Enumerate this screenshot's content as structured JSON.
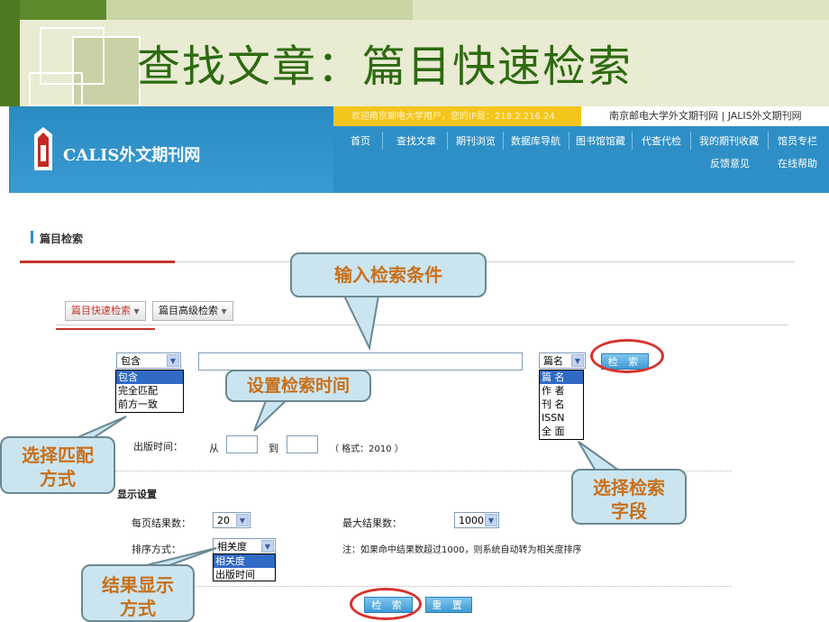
{
  "slide": {
    "title": "查找文章：篇目快速检索"
  },
  "site": {
    "welcome": "欢迎南京邮电大学用户，您的IP是：218.2.216.24",
    "top_links": "南京邮电大学外文期刊网 | JALIS外文期刊网",
    "logo_text": "CALIS外文期刊网",
    "nav_row1": [
      "首页",
      "查找文章",
      "期刊浏览",
      "数据库导航",
      "图书馆馆藏",
      "代查代检",
      "我的期刊收藏",
      "馆员专栏"
    ],
    "nav_row2": [
      "反馈意见",
      "在线帮助"
    ]
  },
  "page": {
    "section_title": "篇目检索",
    "tabs": [
      "篇目快速检索",
      "篇目高级检索"
    ],
    "match_select": {
      "value": "包含",
      "options": [
        "包含",
        "完全匹配",
        "前方一致"
      ]
    },
    "field_select": {
      "value": "篇名",
      "options": [
        "篇 名",
        "作 者",
        "刊 名",
        "ISSN",
        "全 面"
      ]
    },
    "search_button": "检 索",
    "pub_time_label": "出版时间：",
    "from_label": "从",
    "to_label": "到",
    "format_hint": "（ 格式：2010 ）",
    "display_settings": "显示设置",
    "per_page_label": "每页结果数：",
    "per_page_value": "20",
    "max_results_label": "最大结果数：",
    "max_results_value": "1000",
    "sort_label": "排序方式：",
    "sort_select": {
      "value": "相关度",
      "options": [
        "相关度",
        "出版时间"
      ]
    },
    "sort_note": "注：如果命中结果数超过1000，则系统自动转为相关度排序",
    "bottom_search": "检 索",
    "bottom_reset": "重 置"
  },
  "callouts": {
    "input_conditions": "输入检索条件",
    "set_time": "设置检索时间",
    "match_mode_1": "选择匹配",
    "match_mode_2": "方式",
    "search_field_1": "选择检索",
    "search_field_2": "字段",
    "result_display_1": "结果显示",
    "result_display_2": "方式"
  },
  "colors": {
    "header_blue": "#2e8fc6",
    "welcome_yellow": "#f4c51a",
    "callout_text": "#c8701a",
    "callout_bg": "#cbe5f0",
    "slide_title": "#2d6a10",
    "highlight_red": "#d8322c"
  }
}
